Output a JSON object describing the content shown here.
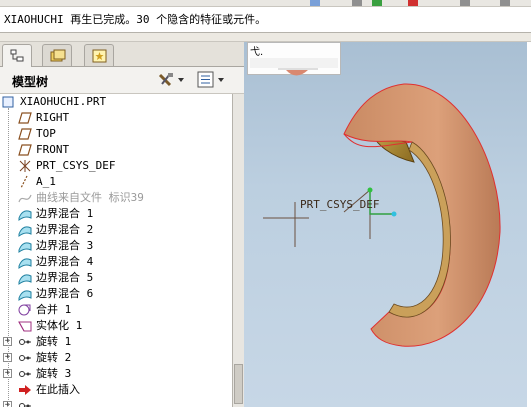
{
  "message": "XIAOHUCHI 再生已完成。30 个隐含的特征或元件。",
  "panel": {
    "tabs": [
      "model-tree-tab",
      "folder-browser-tab",
      "favorites-tab"
    ],
    "title": "模型树"
  },
  "tree": {
    "items": [
      {
        "label": "XIAOHUCHI.PRT",
        "icon": "part-icon",
        "dim": false,
        "expandable": false
      },
      {
        "label": "RIGHT",
        "icon": "datum-plane-icon",
        "dim": false,
        "expandable": false
      },
      {
        "label": "TOP",
        "icon": "datum-plane-icon",
        "dim": false,
        "expandable": false
      },
      {
        "label": "FRONT",
        "icon": "datum-plane-icon",
        "dim": false,
        "expandable": false
      },
      {
        "label": "PRT_CSYS_DEF",
        "icon": "csys-icon",
        "dim": false,
        "expandable": false
      },
      {
        "label": "A_1",
        "icon": "datum-axis-icon",
        "dim": false,
        "expandable": false
      },
      {
        "label": "曲线来自文件 标识39",
        "icon": "curve-icon",
        "dim": true,
        "expandable": false
      },
      {
        "label": "边界混合 1",
        "icon": "boundary-blend-icon",
        "dim": false,
        "expandable": false
      },
      {
        "label": "边界混合 2",
        "icon": "boundary-blend-icon",
        "dim": false,
        "expandable": false
      },
      {
        "label": "边界混合 3",
        "icon": "boundary-blend-icon",
        "dim": false,
        "expandable": false
      },
      {
        "label": "边界混合 4",
        "icon": "boundary-blend-icon",
        "dim": false,
        "expandable": false
      },
      {
        "label": "边界混合 5",
        "icon": "boundary-blend-icon",
        "dim": false,
        "expandable": false
      },
      {
        "label": "边界混合 6",
        "icon": "boundary-blend-icon",
        "dim": false,
        "expandable": false
      },
      {
        "label": "合并 1",
        "icon": "merge-icon",
        "dim": false,
        "expandable": false
      },
      {
        "label": "实体化 1",
        "icon": "solidify-icon",
        "dim": false,
        "expandable": false
      },
      {
        "label": "旋转 1",
        "icon": "revolve-icon",
        "dim": false,
        "expandable": true
      },
      {
        "label": "旋转 2",
        "icon": "revolve-icon",
        "dim": false,
        "expandable": true
      },
      {
        "label": "旋转 3",
        "icon": "revolve-icon",
        "dim": false,
        "expandable": true
      },
      {
        "label": "在此插入",
        "icon": "insert-here-arrow-icon",
        "dim": false,
        "expandable": false
      },
      {
        "label": " ",
        "icon": "revolve-icon",
        "dim": false,
        "expandable": true
      }
    ]
  },
  "viewport": {
    "widget_text": "弋.",
    "csys_label": "PRT_CSYS_DEF",
    "colors": {
      "background_top": "#a9bfd3",
      "model_fill": "#d49a74",
      "edge": "#e03030",
      "rim": "#c8a040"
    }
  }
}
